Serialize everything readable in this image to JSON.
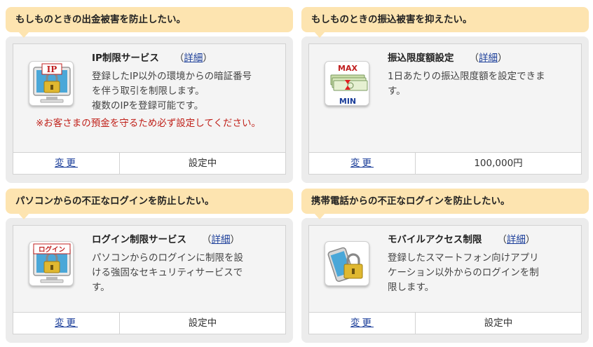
{
  "sections": [
    {
      "heading": "もしものときの出金被害を防止したい。",
      "title": "IP制限サービス",
      "detail_open": "（",
      "detail_link": "詳細",
      "detail_close": "）",
      "icon_label": "IP",
      "description": [
        "登録したIP以外の環境からの暗証番号",
        "を伴う取引を制限します。",
        "複数のIPを登録可能です。"
      ],
      "warning": "※お客さまの預金を守るため必ず設定してください。",
      "change_label": "変更",
      "status": "設定中"
    },
    {
      "heading": "もしものときの振込被害を抑えたい。",
      "title": "振込限度額設定",
      "detail_open": "（",
      "detail_link": "詳細",
      "detail_close": "）",
      "icon_label_top": "MAX",
      "icon_label_bottom": "MIN",
      "description": [
        "1日あたりの振込限度額を設定できま",
        "す。"
      ],
      "change_label": "変更",
      "status": "100,000円"
    },
    {
      "heading": "パソコンからの不正なログインを防止したい。",
      "title": "ログイン制限サービス",
      "detail_open": "（",
      "detail_link": "詳細",
      "detail_close": "）",
      "icon_label": "ログイン",
      "description": [
        "パソコンからのログインに制限を設",
        "ける強固なセキュリティサービスで",
        "す。"
      ],
      "change_label": "変更",
      "status": "設定中"
    },
    {
      "heading": "携帯電話からの不正なログインを防止したい。",
      "title": "モバイルアクセス制限",
      "detail_open": "（",
      "detail_link": "詳細",
      "detail_close": "）",
      "description": [
        "登録したスマートフォン向けアプリ",
        "ケーション以外からのログインを制",
        "限します。"
      ],
      "change_label": "変更",
      "status": "設定中"
    }
  ],
  "colors": {
    "tab_bg": "#fde4b0",
    "panel_bg": "#ececec",
    "link": "#1a3d99",
    "warning": "#c0211a"
  }
}
